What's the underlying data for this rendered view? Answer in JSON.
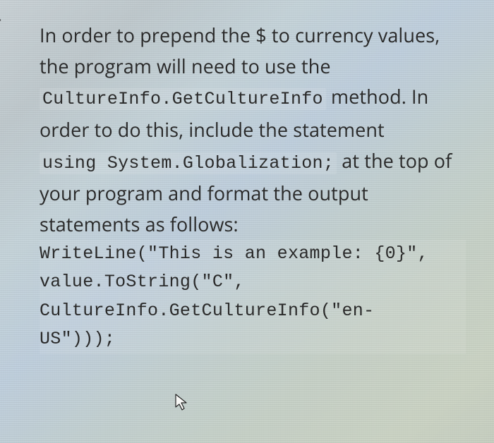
{
  "chevron": "›",
  "para1_a": "In order to prepend the ",
  "para1_b": "$",
  "para1_c": " to currency values, the program will need to use the ",
  "code1": "CultureInfo.GetCultureInfo",
  "para1_d": " method. In order to do this, include the statement ",
  "code2": "using System.Globalization;",
  "para1_e": " at the top of your program and format the output statements as follows:",
  "codeblock": "WriteLine(\"This is an example: {0}\",\nvalue.ToString(\"C\",\nCultureInfo.GetCultureInfo(\"en-\nUS\")));"
}
